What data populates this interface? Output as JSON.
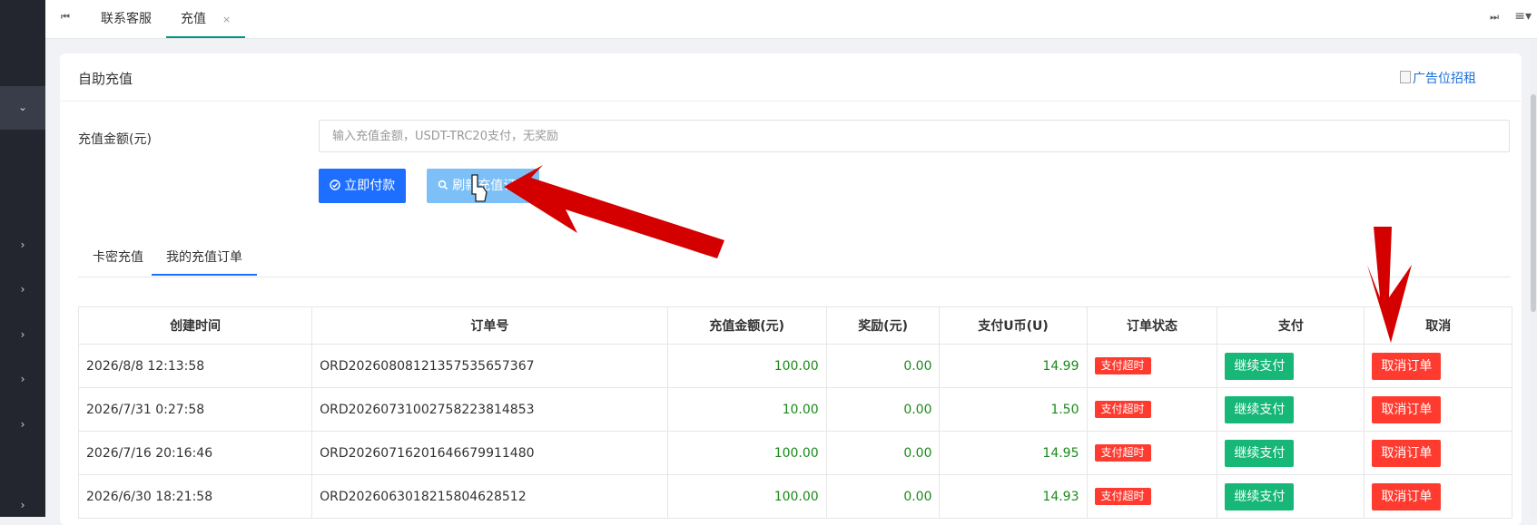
{
  "topbar": {
    "first_icon": "⏮",
    "tabs": [
      {
        "label": "联系客服"
      },
      {
        "label": "充值",
        "close": "×"
      }
    ],
    "last_icon": "⏭",
    "menu_icon": "≡▾"
  },
  "sidebar": {
    "active_arrow": "⌄",
    "arrows": [
      "›",
      "›",
      "›",
      "›",
      "›",
      "›"
    ]
  },
  "card": {
    "title": "自助充值",
    "ad_link": "广告位招租"
  },
  "form": {
    "amount_label": "充值金额(元)",
    "amount_placeholder": "输入充值金额，USDT-TRC20支付，无奖励",
    "pay_button": "立即付款",
    "refresh_button": "刷新充值订单"
  },
  "tabs": [
    {
      "label": "卡密充值",
      "active": false
    },
    {
      "label": "我的充值订单",
      "active": true
    }
  ],
  "table": {
    "headers": [
      "创建时间",
      "订单号",
      "充值金额(元)",
      "奖励(元)",
      "支付U币(U)",
      "订单状态",
      "支付",
      "取消"
    ],
    "rows": [
      {
        "time": "2026/8/8 12:13:58",
        "order_no": "ORD2026080812135753565736​7",
        "amount": "100.00",
        "bonus": "0.00",
        "usdt": "14.99",
        "status": "支付超时",
        "pay": "继续支付",
        "cancel": "取消订单"
      },
      {
        "time": "2026/7/31 0:27:58",
        "order_no": "ORD2026073100275822381485​3",
        "amount": "10.00",
        "bonus": "0.00",
        "usdt": "1.50",
        "status": "支付超时",
        "pay": "继续支付",
        "cancel": "取消订单"
      },
      {
        "time": "2026/7/16 20:16:46",
        "order_no": "ORD2026071620164667991148​0",
        "amount": "100.00",
        "bonus": "0.00",
        "usdt": "14.95",
        "status": "支付超时",
        "pay": "继续支付",
        "cancel": "取消订单"
      },
      {
        "time": "2026/6/30 18:21:58",
        "order_no": "ORD2026063018215804628512",
        "amount": "100.00",
        "bonus": "0.00",
        "usdt": "14.93",
        "status": "支付超时",
        "pay": "继续支付",
        "cancel": "取消订单"
      }
    ]
  },
  "colors": {
    "primary": "#1e6fff",
    "refresh_disabled": "#7cc0f7",
    "success": "#16b777",
    "danger": "#ff3b30",
    "amount_text": "#1a8a1a",
    "annotation": "#d40000"
  }
}
